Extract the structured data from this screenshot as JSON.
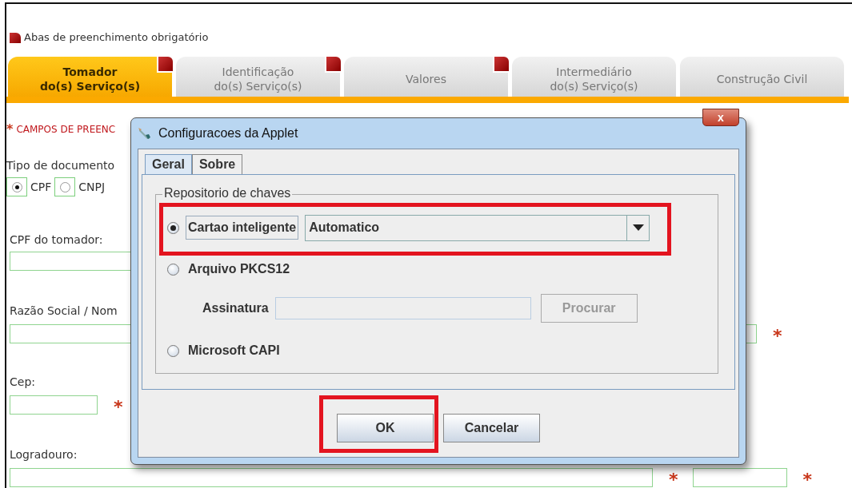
{
  "legend": {
    "text": "Abas de preenchimento obrigatório"
  },
  "tabs": [
    {
      "label": "Tomador\ndo(s) Serviço(s)",
      "selected": true,
      "required": true
    },
    {
      "label": "Identificação\ndo(s) Serviço(s)",
      "selected": false,
      "required": true
    },
    {
      "label": "Valores",
      "selected": false,
      "required": true
    },
    {
      "label": "Intermediário\ndo(s) Serviço(s)",
      "selected": false,
      "required": false
    },
    {
      "label": "Construção Civil",
      "selected": false,
      "required": false
    }
  ],
  "form": {
    "required_note": {
      "mark": "*",
      "text": "CAMPOS DE PREENC"
    },
    "document_type": {
      "label": "Tipo de documento",
      "options": [
        {
          "label": "CPF",
          "selected": true
        },
        {
          "label": "CNPJ",
          "selected": false
        }
      ]
    },
    "fields": [
      {
        "label": "CPF do tomador:",
        "inputs": [
          {
            "kind": "wide"
          }
        ]
      },
      {
        "label": "Razão Social / Nom",
        "inputs": [
          {
            "kind": "full",
            "mark": "*"
          }
        ]
      },
      {
        "label": "Cep:",
        "inputs": [
          {
            "kind": "small",
            "mark": "*"
          }
        ]
      },
      {
        "label": "Logradouro:",
        "inputs": [
          {
            "kind": "long",
            "mark": "*"
          },
          {
            "kind": "medium",
            "mark": "*"
          }
        ]
      }
    ]
  },
  "dialog": {
    "title": "Configuracoes da Applet",
    "close": "x",
    "tabs": [
      {
        "label": "Geral",
        "selected": true
      },
      {
        "label": "Sobre",
        "selected": false
      }
    ],
    "group": "Repositorio de chaves",
    "options": [
      {
        "kind": "select",
        "label": "Cartao inteligente",
        "selected": true,
        "highlighted": true,
        "value": "Automatico"
      },
      {
        "kind": "file",
        "label": "Arquivo PKCS12",
        "selected": false,
        "highlighted": false,
        "field_label": "Assinatura",
        "button": "Procurar",
        "disabled": true
      },
      {
        "kind": "plain",
        "label": "Microsoft CAPI",
        "selected": false,
        "highlighted": false
      }
    ],
    "buttons": [
      {
        "label": "OK",
        "highlighted": true
      },
      {
        "label": "Cancelar",
        "highlighted": false
      }
    ]
  }
}
